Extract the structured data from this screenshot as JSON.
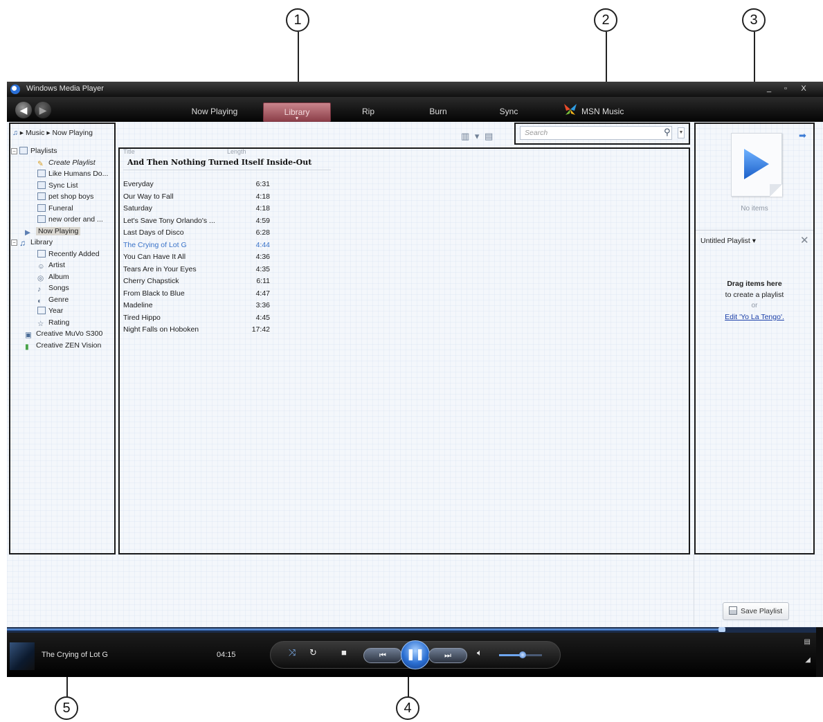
{
  "window": {
    "title": "Windows Media Player",
    "controls": [
      "_",
      "▫",
      "X"
    ]
  },
  "callouts": [
    "1",
    "2",
    "3",
    "4",
    "5"
  ],
  "tabs": [
    {
      "label": "Now Playing",
      "active": false
    },
    {
      "label": "Library",
      "active": true
    },
    {
      "label": "Rip",
      "active": false
    },
    {
      "label": "Burn",
      "active": false
    },
    {
      "label": "Sync",
      "active": false
    },
    {
      "label": "MSN Music",
      "active": false
    }
  ],
  "breadcrumb": {
    "root": "Music",
    "sep": "▸",
    "current": "Now Playing"
  },
  "nav_tree": {
    "playlists_label": "Playlists",
    "playlists": [
      "Create Playlist",
      "Like Humans Do...",
      "Sync List",
      "pet shop boys",
      "Funeral",
      "new order and ..."
    ],
    "now_playing": "Now Playing",
    "library_label": "Library",
    "library_items": [
      "Recently Added",
      "Artist",
      "Album",
      "Songs",
      "Genre",
      "Year",
      "Rating"
    ],
    "devices": [
      "Creative MuVo S300",
      "Creative ZEN Vision"
    ]
  },
  "search": {
    "placeholder": "Search"
  },
  "details": {
    "col_title": "Title",
    "col_length": "Length",
    "album": "And Then Nothing Turned Itself Inside-Out",
    "tracks": [
      {
        "title": "Everyday",
        "length": "6:31"
      },
      {
        "title": "Our Way to Fall",
        "length": "4:18"
      },
      {
        "title": "Saturday",
        "length": "4:18"
      },
      {
        "title": "Let's Save Tony Orlando's ...",
        "length": "4:59"
      },
      {
        "title": "Last Days of Disco",
        "length": "6:28"
      },
      {
        "title": "The Crying of Lot G",
        "length": "4:44",
        "playing": true
      },
      {
        "title": "You Can Have It All",
        "length": "4:36"
      },
      {
        "title": "Tears Are in Your Eyes",
        "length": "4:35"
      },
      {
        "title": "Cherry Chapstick",
        "length": "6:11"
      },
      {
        "title": "From Black to Blue",
        "length": "4:47"
      },
      {
        "title": "Madeline",
        "length": "3:36"
      },
      {
        "title": "Tired Hippo",
        "length": "4:45"
      },
      {
        "title": "Night Falls on Hoboken",
        "length": "17:42"
      }
    ]
  },
  "list_pane": {
    "no_items": "No items",
    "playlist_name": "Untitled Playlist",
    "drag_bold": "Drag items here",
    "drag_sub": "to create a playlist",
    "or": "or",
    "edit_link": "Edit 'Yo La Tengo'.",
    "save_button": "Save Playlist"
  },
  "player": {
    "now_playing_title": "The Crying of Lot G",
    "time": "04:15",
    "seek_progress": 0.884,
    "volume": 0.55
  },
  "colors": {
    "accent_tab": "#8c3f49",
    "link": "#1a3ea8",
    "playing_track": "#3a73c9",
    "play_button": "#2b6fd2"
  }
}
